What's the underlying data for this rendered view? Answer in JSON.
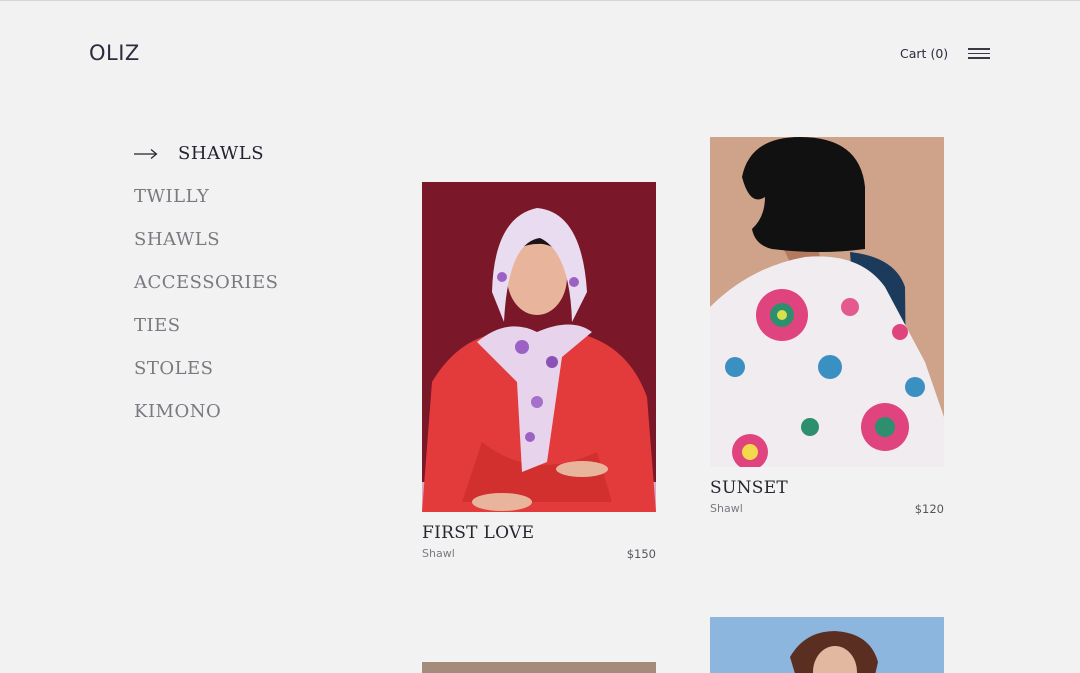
{
  "header": {
    "logo": "OLIZ",
    "cart_label": "Cart",
    "cart_count": "(0)"
  },
  "nav": {
    "active": "SHAWLS",
    "items": [
      {
        "label": "TWILLY"
      },
      {
        "label": "SHAWLS"
      },
      {
        "label": "ACCESSORIES"
      },
      {
        "label": "TIES"
      },
      {
        "label": "STOLES"
      },
      {
        "label": "KIMONO"
      }
    ]
  },
  "products": [
    {
      "title": "FIRST LOVE",
      "category": "Shawl",
      "price": "$150"
    },
    {
      "title": "SUNSET",
      "category": "Shawl",
      "price": "$120"
    }
  ],
  "colors": {
    "background": "#f2f2f3",
    "text_dark": "#2b2a35",
    "text_muted": "#7a7980"
  }
}
